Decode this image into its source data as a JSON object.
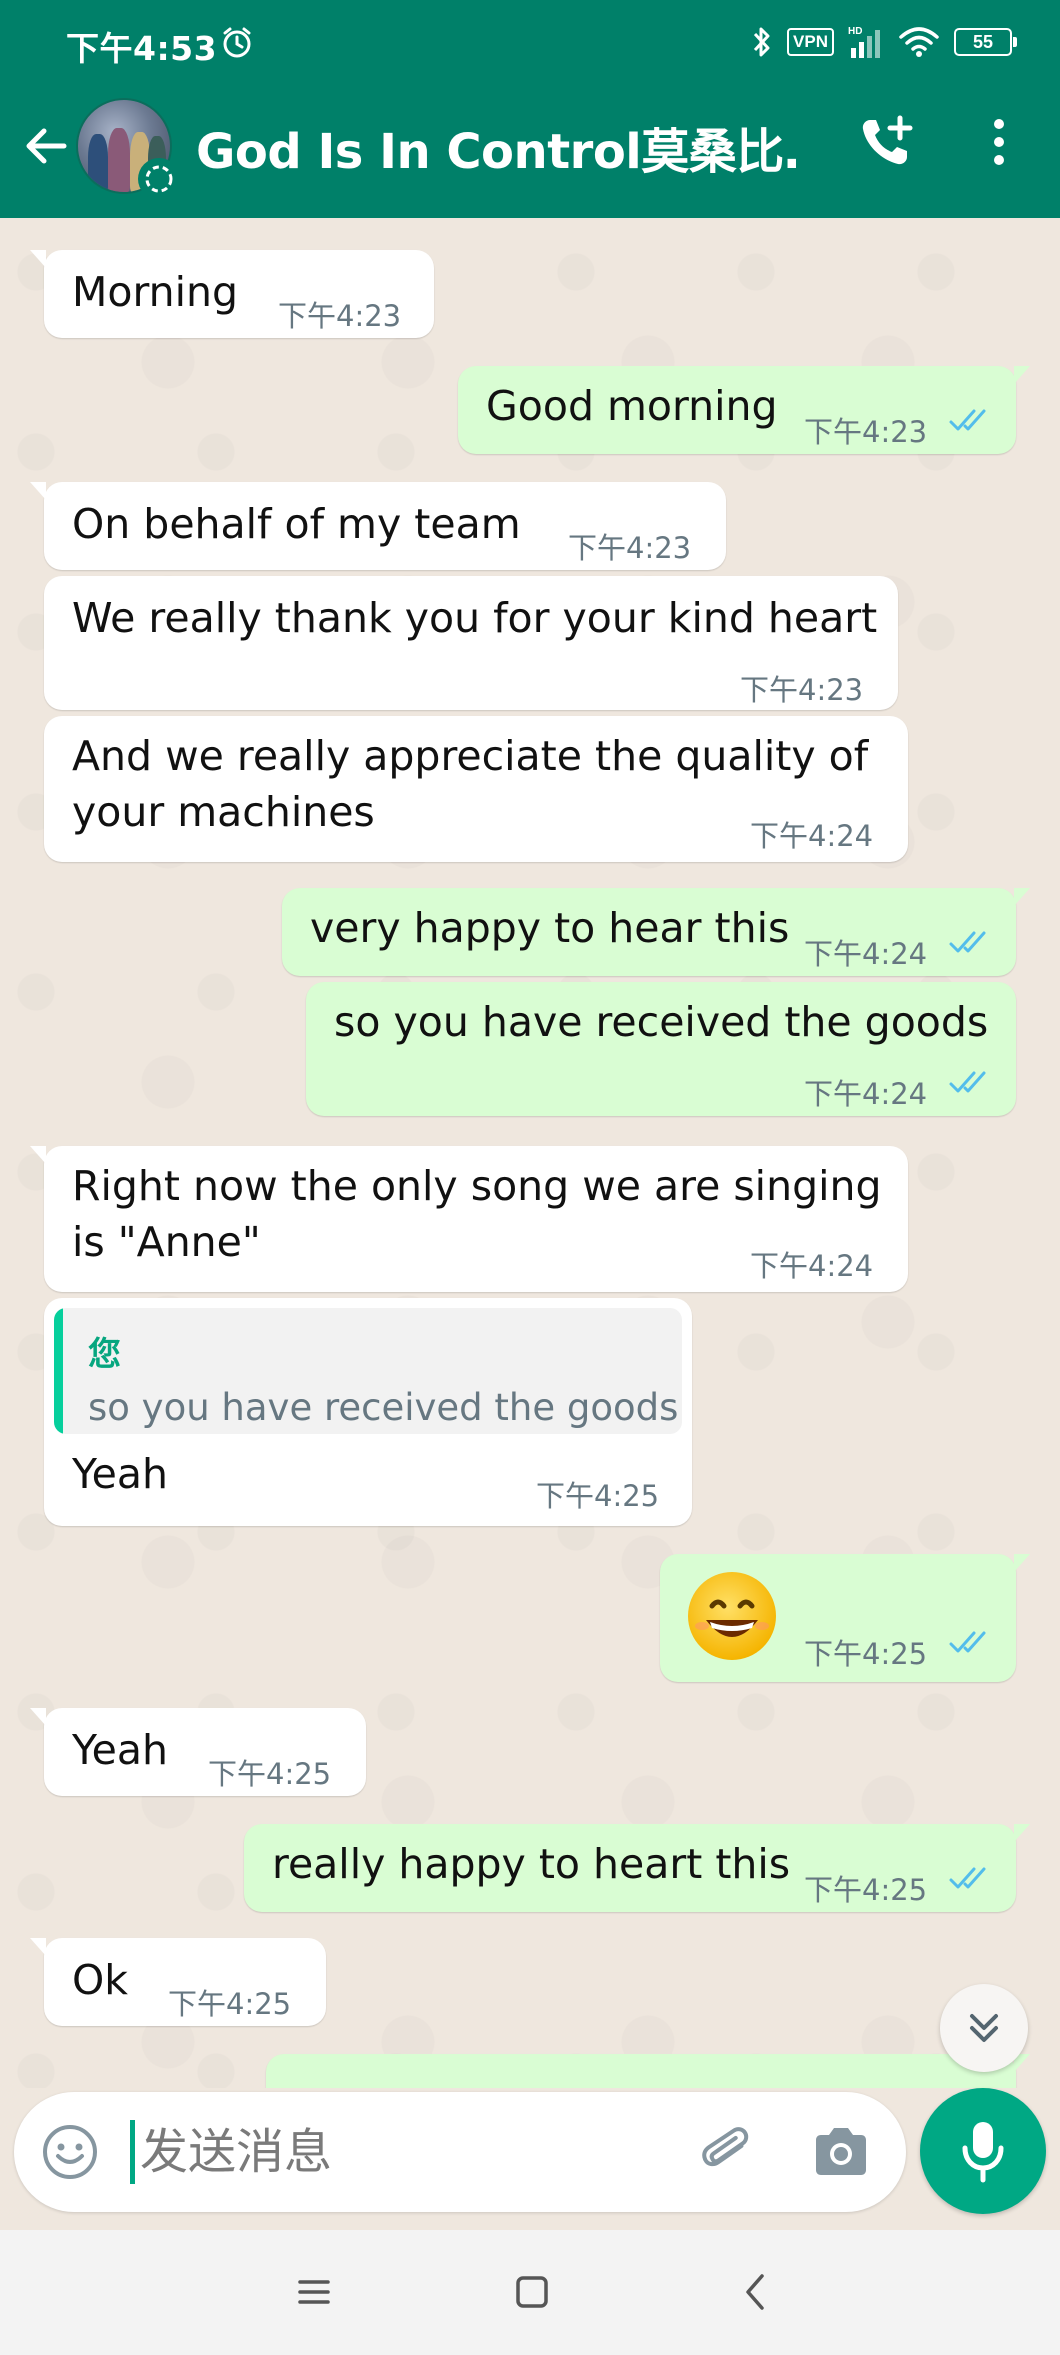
{
  "status_bar": {
    "time": "下午4:53",
    "vpn": "VPN",
    "hd": "HD",
    "battery": "55"
  },
  "header": {
    "title": "God Is In Control莫桑比…"
  },
  "messages": [
    {
      "dir": "in",
      "text": "Morning",
      "time": "下午4:23"
    },
    {
      "dir": "out",
      "text": "Good morning",
      "time": "下午4:23"
    },
    {
      "dir": "in",
      "text": "On behalf of my team",
      "time": "下午4:23"
    },
    {
      "dir": "in",
      "text": "We really thank you for your kind heart",
      "time": "下午4:23"
    },
    {
      "dir": "in",
      "lines": [
        "And we really appreciate the quality of",
        "your machines"
      ],
      "time": "下午4:24"
    },
    {
      "dir": "out",
      "text": "very happy to hear this",
      "time": "下午4:24"
    },
    {
      "dir": "out",
      "text": "so you have received the goods",
      "time": "下午4:24"
    },
    {
      "dir": "in",
      "lines": [
        "Right now the only song we are singing",
        "is \"Anne\""
      ],
      "time": "下午4:24"
    },
    {
      "dir": "in",
      "quote_author": "您",
      "quote_text": "so you have received the goods",
      "text": "Yeah",
      "time": "下午4:25"
    },
    {
      "dir": "out",
      "emoji": "grinning-face",
      "time": "下午4:25"
    },
    {
      "dir": "in",
      "text": "Yeah",
      "time": "下午4:25"
    },
    {
      "dir": "out",
      "text": "really happy to heart this",
      "time": "下午4:25"
    },
    {
      "dir": "in",
      "text": "Ok",
      "time": "下午4:25"
    }
  ],
  "composer": {
    "placeholder": "发送消息"
  },
  "colors": {
    "header": "#008069",
    "chat_bg": "#efe7de",
    "outgoing_bubble": "#d9fdd3",
    "incoming_bubble": "#ffffff",
    "read_ticks": "#53bdeb",
    "accent": "#00a884"
  },
  "icons": {
    "back": "arrow-left-icon",
    "call": "add-call-icon",
    "menu": "more-vertical-icon",
    "emoji": "emoji-icon",
    "attach": "paperclip-icon",
    "camera": "camera-icon",
    "mic": "microphone-icon",
    "scroll": "double-chevron-down-icon",
    "nav": [
      "menu-lines-icon",
      "home-square-icon",
      "back-chevron-icon"
    ]
  }
}
